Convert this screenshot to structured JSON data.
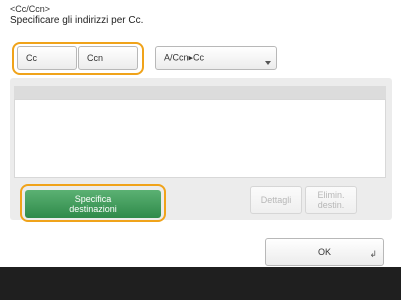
{
  "header": {
    "title_small": "<Cc/Ccn>",
    "subtitle": "Specificare gli indirizzi per Cc."
  },
  "tabs": [
    {
      "label": "Cc"
    },
    {
      "label": "Ccn"
    },
    {
      "label": "A/Ccn▸Cc"
    }
  ],
  "buttons": {
    "specify_destinations": "Specifica\ndestinazioni",
    "details": "Dettagli",
    "delete_destination": "Elimin.\ndestin.",
    "ok": "OK"
  },
  "colors": {
    "highlight": "#f0a31a",
    "green": "#3a9655"
  }
}
